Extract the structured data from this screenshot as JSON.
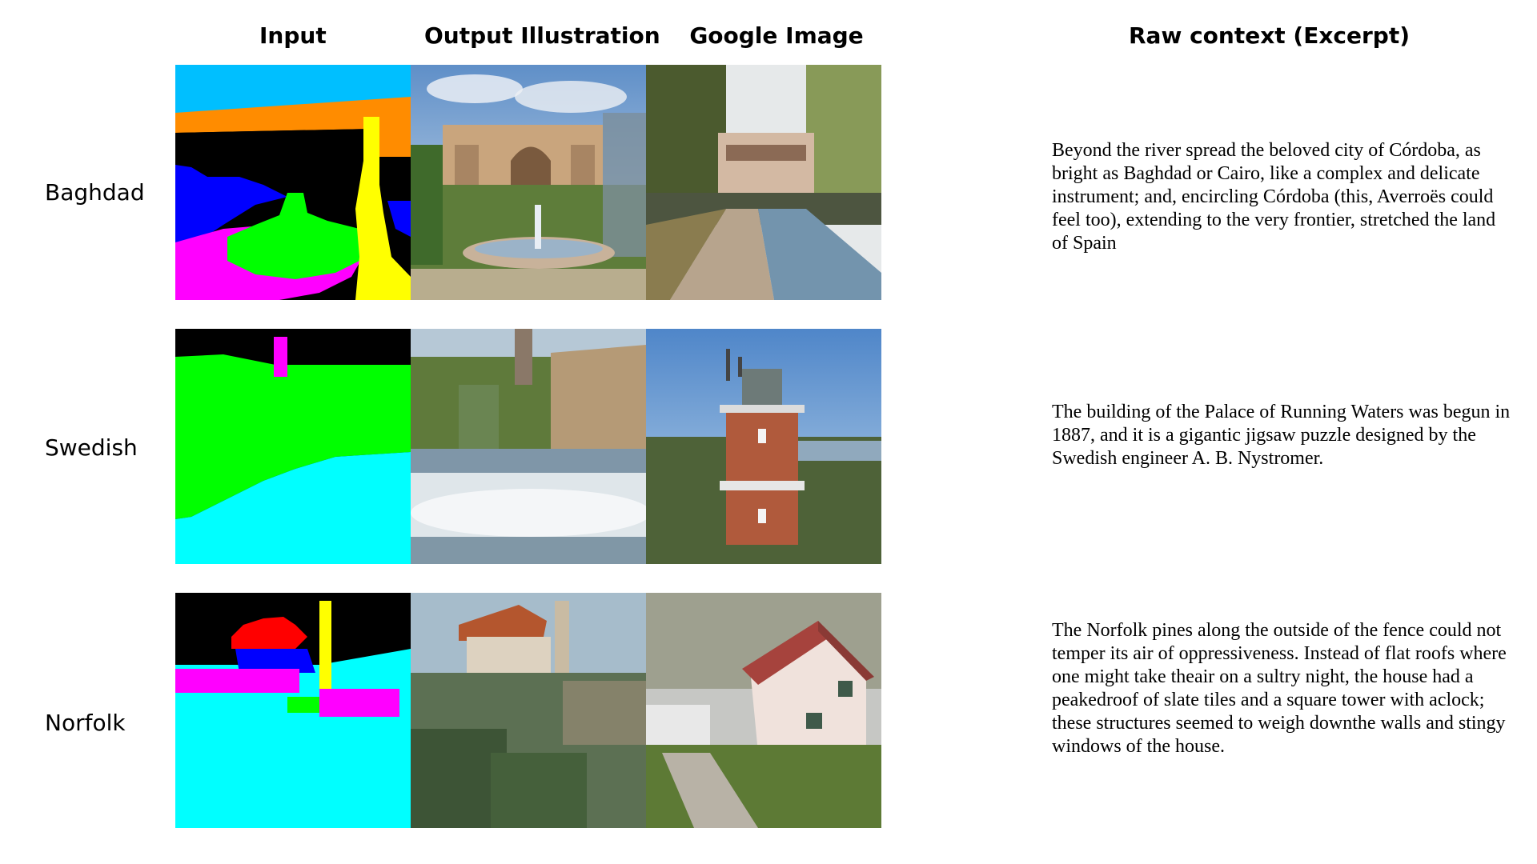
{
  "headers": {
    "input": "Input",
    "output": "Output Illustration",
    "google": "Google Image",
    "context": "Raw context (Excerpt)"
  },
  "rows": [
    {
      "label": "Baghdad",
      "context": "Beyond the river spread the beloved city of Córdoba, as bright as Baghdad or Cairo, like a complex and delicate instrument; and, encircling Córdoba (this, Averroës could feel too), extending to the very frontier, stretched the land of Spain"
    },
    {
      "label": "Swedish",
      "context": "The building of the Palace of Running Waters was begun in 1887, and it is a gigantic jigsaw puzzle designed by the Swedish engineer A. B. Nystromer."
    },
    {
      "label": "Norfolk",
      "context": "The Norfolk pines along the outside of the fence could not temper its air of oppressiveness. Instead of flat roofs where one might take theair on a sultry night, the house had a peakedroof of slate tiles and a square tower with aclock; these structures seemed to weigh downthe walls and stingy windows of the house."
    }
  ],
  "colors": {
    "sky_cyan": "#00bfff",
    "orange": "#ff8c00",
    "black": "#000000",
    "blue": "#0000ff",
    "magenta": "#ff00ff",
    "green": "#00ff00",
    "yellow": "#ffff00",
    "aqua": "#00ffff",
    "red": "#ff0000"
  }
}
